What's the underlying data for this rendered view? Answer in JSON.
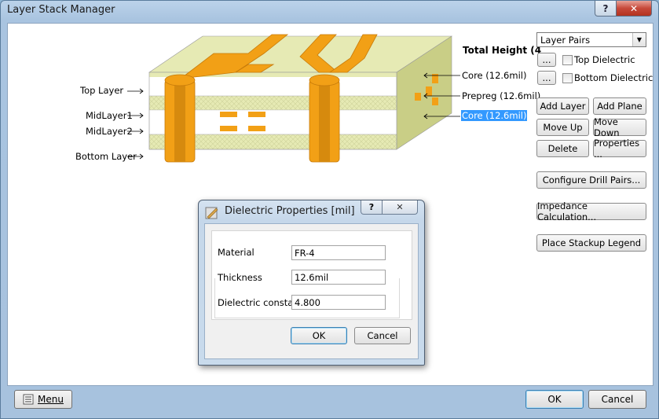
{
  "window": {
    "title": "Layer Stack Manager",
    "help_label": "?",
    "close_label": "✕"
  },
  "diagram": {
    "left_labels": [
      "Top Layer",
      "MidLayer1",
      "MidLayer2",
      "Bottom Layer"
    ],
    "total_height": "Total Height (4",
    "right_labels": [
      "Core (12.6mil)",
      "Prepreg (12.6mil)",
      "Core (12.6mil)"
    ],
    "selected_index": 2,
    "colors": {
      "board_top": "#e6eab4",
      "board_side": "#c7cc82",
      "copper": "#f2a016",
      "copper_dark": "#c67a0a",
      "selection": "#3399ff"
    }
  },
  "side": {
    "layer_pairs": "Layer Pairs",
    "top_dielectric_btn": "...",
    "top_dielectric": "Top Dielectric",
    "bottom_dielectric_btn": "...",
    "bottom_dielectric": "Bottom Dielectric",
    "add_layer": "Add Layer",
    "add_plane": "Add Plane",
    "move_up": "Move Up",
    "move_down": "Move Down",
    "delete": "Delete",
    "properties": "Properties ...",
    "configure_drill_pairs": "Configure Drill Pairs...",
    "impedance_calculation": "Impedance Calculation...",
    "place_stackup_legend": "Place Stackup Legend"
  },
  "footer": {
    "menu": "Menu",
    "ok": "OK",
    "cancel": "Cancel"
  },
  "dialog": {
    "title": "Dielectric Properties [mil]",
    "help_label": "?",
    "close_label": "✕",
    "material_label": "Material",
    "material_value": "FR-4",
    "thickness_label": "Thickness",
    "thickness_value": "12.6mil",
    "dielectric_constant_label": "Dielectric constant",
    "dielectric_constant_value": "4.800",
    "ok": "OK",
    "cancel": "Cancel"
  }
}
